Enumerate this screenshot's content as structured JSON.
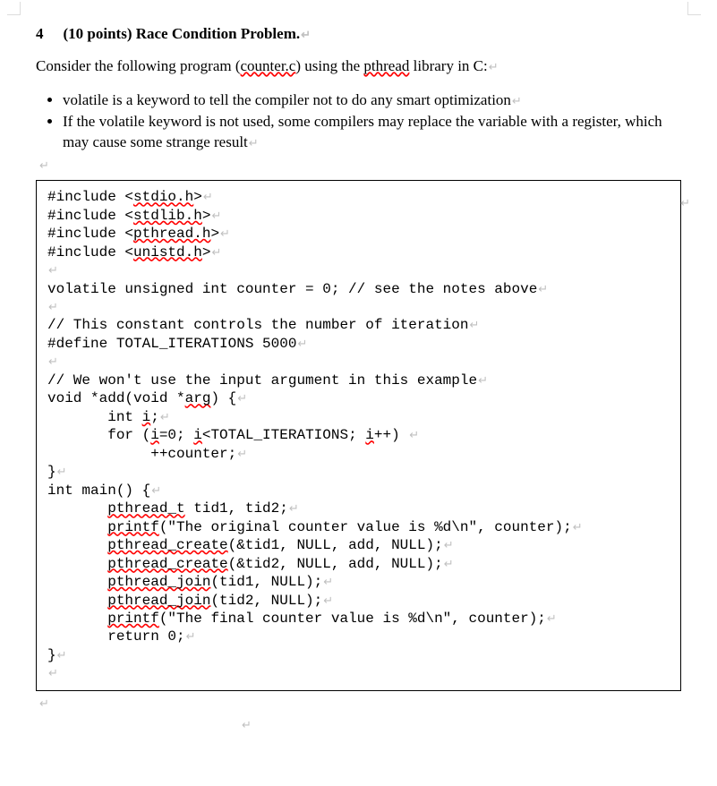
{
  "heading": {
    "number": "4",
    "points": "(10 points)",
    "title": "Race Condition Problem."
  },
  "intro": {
    "pre": "Consider the following program (",
    "file": "counter.c",
    "mid": ") using the ",
    "lib": "pthread",
    "post": " library in C:"
  },
  "bullets": [
    "volatile is a keyword to tell the compiler not to do any smart optimization",
    "If the volatile keyword is not used, some compilers may replace the variable with a register, which may cause some strange result"
  ],
  "code": {
    "lines": [
      {
        "segments": [
          {
            "t": "#include <"
          },
          {
            "t": "stdio.h",
            "spell": true
          },
          {
            "t": ">"
          }
        ]
      },
      {
        "segments": [
          {
            "t": "#include <"
          },
          {
            "t": "stdlib.h",
            "spell": true
          },
          {
            "t": ">"
          }
        ]
      },
      {
        "segments": [
          {
            "t": "#include <"
          },
          {
            "t": "pthread.h",
            "spell": true
          },
          {
            "t": ">"
          }
        ]
      },
      {
        "segments": [
          {
            "t": "#include <"
          },
          {
            "t": "unistd.h",
            "spell": true
          },
          {
            "t": ">"
          }
        ]
      },
      {
        "segments": []
      },
      {
        "segments": [
          {
            "t": "volatile unsigned int counter = 0; // see the notes above"
          }
        ]
      },
      {
        "segments": []
      },
      {
        "segments": [
          {
            "t": "// This constant controls the number of iteration"
          }
        ]
      },
      {
        "segments": [
          {
            "t": "#define TOTAL_ITERATIONS 5000"
          }
        ]
      },
      {
        "segments": []
      },
      {
        "segments": [
          {
            "t": "// We won't use the input argument in this example"
          }
        ]
      },
      {
        "segments": [
          {
            "t": "void *add(void *"
          },
          {
            "t": "arg",
            "spell": true
          },
          {
            "t": ") {"
          }
        ]
      },
      {
        "segments": [
          {
            "t": "       int "
          },
          {
            "t": "i",
            "spell": true
          },
          {
            "t": ";"
          }
        ]
      },
      {
        "segments": [
          {
            "t": "       for ("
          },
          {
            "t": "i",
            "spell": true
          },
          {
            "t": "=0; "
          },
          {
            "t": "i",
            "spell": true
          },
          {
            "t": "<TOTAL_ITERATIONS; "
          },
          {
            "t": "i",
            "spell": true
          },
          {
            "t": "++) "
          }
        ]
      },
      {
        "segments": [
          {
            "t": "            ++counter;"
          }
        ]
      },
      {
        "segments": [
          {
            "t": "}"
          }
        ]
      },
      {
        "segments": [
          {
            "t": "int main() {"
          }
        ]
      },
      {
        "segments": [
          {
            "t": "       "
          },
          {
            "t": "pthread_t",
            "spell": true
          },
          {
            "t": " tid1, tid2;"
          }
        ]
      },
      {
        "segments": [
          {
            "t": "       "
          },
          {
            "t": "printf",
            "spell": true
          },
          {
            "t": "(\"The original counter value is %d\\n\", counter);"
          }
        ]
      },
      {
        "segments": [
          {
            "t": "       "
          },
          {
            "t": "pthread_create",
            "spell": true
          },
          {
            "t": "(&tid1, NULL, add, NULL);"
          }
        ]
      },
      {
        "segments": [
          {
            "t": "       "
          },
          {
            "t": "pthread_create",
            "spell": true
          },
          {
            "t": "(&tid2, NULL, add, NULL);"
          }
        ]
      },
      {
        "segments": [
          {
            "t": "       "
          },
          {
            "t": "pthread_join",
            "spell": true
          },
          {
            "t": "(tid1, NULL);"
          }
        ]
      },
      {
        "segments": [
          {
            "t": "       "
          },
          {
            "t": "pthread_join",
            "spell": true
          },
          {
            "t": "(tid2, NULL);"
          }
        ]
      },
      {
        "segments": [
          {
            "t": "       "
          },
          {
            "t": "printf",
            "spell": true
          },
          {
            "t": "(\"The final counter value is %d\\n\", counter);"
          }
        ]
      },
      {
        "segments": [
          {
            "t": "       return 0;"
          }
        ]
      },
      {
        "segments": [
          {
            "t": "}"
          }
        ]
      },
      {
        "segments": []
      }
    ]
  },
  "pilcrow": "↵"
}
